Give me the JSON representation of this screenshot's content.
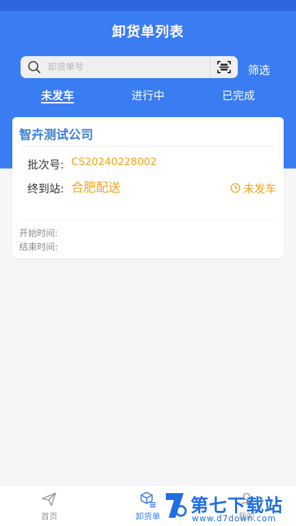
{
  "header": {
    "title": "卸货单列表"
  },
  "search": {
    "placeholder": "卸货单号",
    "filter_label": "筛选"
  },
  "tabs": [
    {
      "label": "未发车",
      "active": true
    },
    {
      "label": "进行中",
      "active": false
    },
    {
      "label": "已完成",
      "active": false
    }
  ],
  "orders": [
    {
      "company": "智卉测试公司",
      "batch_label": "批次号:",
      "batch_no": "CS20240228002",
      "station_label": "终到站:",
      "station": "合肥配送",
      "status": "未发车",
      "start_label": "开始时间:",
      "end_label": "结束时间:"
    }
  ],
  "bottom_nav": [
    {
      "label": "首页",
      "icon": "paper-plane-icon",
      "active": false
    },
    {
      "label": "卸货单",
      "icon": "cube-list-icon",
      "active": true
    },
    {
      "label": "我的",
      "icon": "user-icon",
      "active": false
    }
  ],
  "watermark": {
    "text": "第七下载站",
    "url": "www.d7down.com"
  },
  "colors": {
    "primary": "#3a7cf2",
    "accent_orange": "#f3a21b",
    "company_blue": "#3b7fd9"
  }
}
